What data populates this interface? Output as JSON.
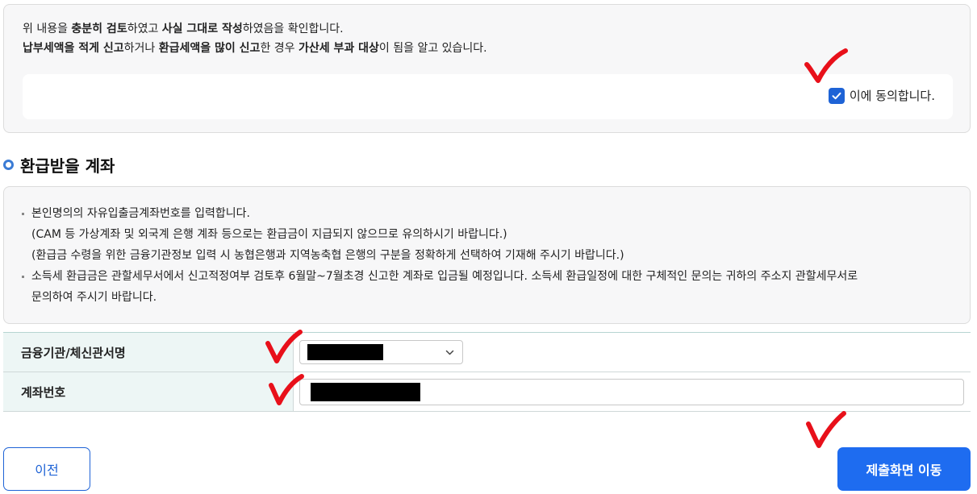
{
  "confirm": {
    "line1": [
      {
        "text": "위 내용을 ",
        "bold": false
      },
      {
        "text": "충분히 검토",
        "bold": true
      },
      {
        "text": "하였고 ",
        "bold": false
      },
      {
        "text": "사실 그대로 작성",
        "bold": true
      },
      {
        "text": "하였음을 확인합니다.",
        "bold": false
      }
    ],
    "line2": [
      {
        "text": "납부세액을 적게 신고",
        "bold": true
      },
      {
        "text": "하거나 ",
        "bold": false
      },
      {
        "text": "환급세액을 많이 신고",
        "bold": true
      },
      {
        "text": "한 경우 ",
        "bold": false
      },
      {
        "text": "가산세 부과 대상",
        "bold": true
      },
      {
        "text": "이 됨을 알고 있습니다.",
        "bold": false
      }
    ],
    "agree_label": "이에 동의합니다.",
    "agree_checked": true
  },
  "section": {
    "title": "환급받을 계좌"
  },
  "notice": {
    "lines": [
      {
        "text": "본인명의의 자유입출금계좌번호를 입력합니다.",
        "dot": true
      },
      {
        "text": "(CAM 등 가상계좌 및 외국계 은행 계좌 등으로는 환급금이 지급되지 않으므로 유의하시기 바랍니다.)",
        "dot": false
      },
      {
        "text": "(환급금 수령을 위한 금융기관정보 입력 시 농협은행과 지역농축협 은행의 구분을 정확하게 선택하여 기재해 주시기 바랍니다.)",
        "dot": false
      },
      {
        "text": "소득세 환급금은 관할세무서에서 신고적정여부 검토후 6월말~7월초경 신고한 계좌로 입금될 예정입니다. 소득세 환급일정에 대한 구체적인 문의는 귀하의 주소지 관할세무서로",
        "dot": true
      },
      {
        "text": "문의하여 주시기 바랍니다.",
        "dot": false
      }
    ]
  },
  "form": {
    "bank_label": "금융기관/체신관서명",
    "account_label": "계좌번호"
  },
  "buttons": {
    "prev": "이전",
    "submit": "제출화면 이동"
  },
  "colors": {
    "primary": "#1e6cf0",
    "checkbox": "#1e63d6",
    "annotation": "#e8101a"
  },
  "icons": {
    "checkbox": "check-icon",
    "select": "chevron-down-icon",
    "section": "ring-bullet-icon",
    "annotation": "red-checkmark"
  }
}
